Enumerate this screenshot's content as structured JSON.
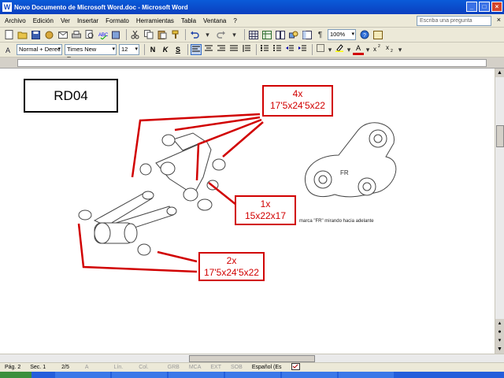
{
  "window": {
    "title": "Novo Documento de Microsoft Word.doc - Microsoft Word",
    "app_icon": "W"
  },
  "menu": {
    "items": [
      "Archivo",
      "Edición",
      "Ver",
      "Insertar",
      "Formato",
      "Herramientas",
      "Tabla",
      "Ventana",
      "?"
    ],
    "help_placeholder": "Escriba una pregunta",
    "close_glyph": "×"
  },
  "toolbar": {
    "zoom": "100%"
  },
  "format": {
    "style": "Normal + Derec",
    "font": "Times New Roman",
    "size": "12",
    "bold": "N",
    "italic": "K",
    "underline": "S",
    "font_color_glyph": "A"
  },
  "document": {
    "label_box": "RD04",
    "callout_top": {
      "qty": "4x",
      "dims": "17'5x24'5x22"
    },
    "callout_mid": {
      "qty": "1x",
      "dims": "15x22x17"
    },
    "callout_bottom": {
      "qty": "2x",
      "dims": "17'5x24'5x22"
    },
    "part_stamp": "FR",
    "caption": "marca \"FR\" mirando hacia adelante"
  },
  "status": {
    "page": "Pág. 2",
    "section": "Sec. 1",
    "pages": "2/5",
    "at": "A",
    "line": "Lín.",
    "col": "Col.",
    "grb": "GRB",
    "mca": "MCA",
    "ext": "EXT",
    "sob": "SOB",
    "lang": "Español (Es"
  },
  "colors": {
    "callout": "#d10000",
    "titlebar": "#0a5bd9"
  }
}
